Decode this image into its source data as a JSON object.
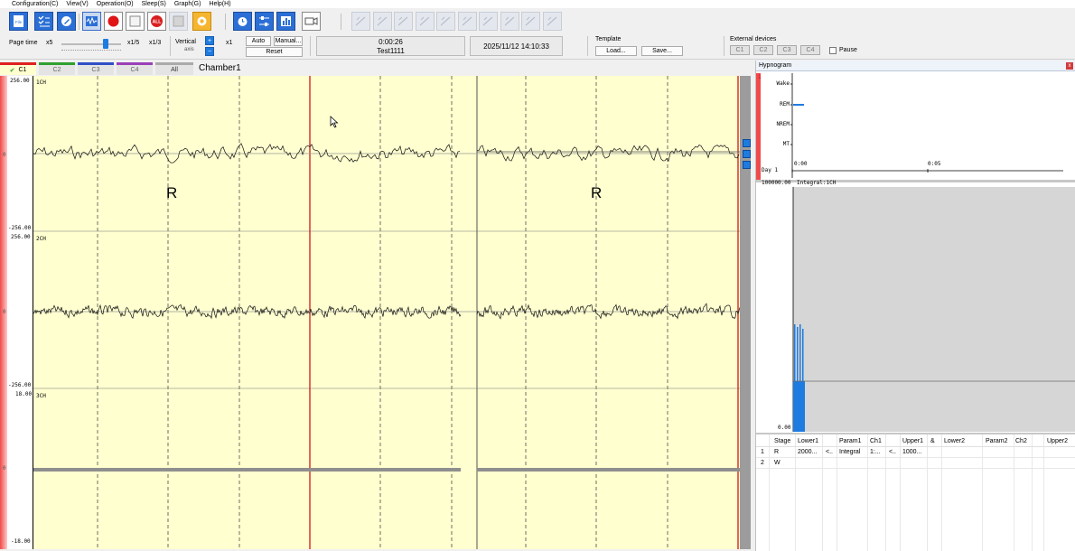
{
  "menu": [
    "Configuration(C)",
    "View(V)",
    "Operation(O)",
    "Sleep(S)",
    "Graph(G)",
    "Help(H)"
  ],
  "toolbar": {
    "file_label": "File",
    "all_label": "ALL"
  },
  "controls": {
    "page_time_label": "Page time",
    "page_time_value": "x5",
    "zoom_a": "x1/5",
    "zoom_b": "x1/3",
    "vertical_label": "Vertical",
    "axis_label": "axis",
    "plus": "+",
    "minus": "−",
    "vertical_value": "x1",
    "auto": "Auto",
    "manual": "Manual...",
    "reset": "Reset",
    "elapsed": "0:00:26",
    "recording_name": "Test1111",
    "datetime": "2025/11/12 14:10:33",
    "template_label": "Template",
    "load": "Load...",
    "save": "Save...",
    "external_label": "External devices",
    "ext": [
      "C1",
      "C2",
      "C3",
      "C4"
    ],
    "pause": "Pause"
  },
  "tabs": [
    "C1",
    "C2",
    "C3",
    "C4",
    "All"
  ],
  "chamber": "Chamber1",
  "channels": [
    {
      "name": "1CH",
      "top": "256.00",
      "bottom": "-256.00",
      "zero": "0"
    },
    {
      "name": "2CH",
      "top": "256.00",
      "bottom": "-256.00",
      "zero": "0"
    },
    {
      "name": "3CH",
      "top": "18.00",
      "bottom": "-18.00",
      "zero": "0"
    }
  ],
  "stage_markers": [
    "R",
    "R"
  ],
  "colors": {
    "plot_bg": "#ffffd0",
    "cursor": "#d01818",
    "bar": "#1e7be0"
  },
  "hypnogram": {
    "title": "Hypnogram",
    "close": "x",
    "stages": [
      "Wake",
      "REM",
      "NREM",
      "MT"
    ],
    "day": "Day 1",
    "t0": "0:00",
    "t1": "0:05",
    "channel_num": "1",
    "integral_top": "100000.00",
    "integral_label": "Integral:1CH",
    "integral_bottom": "0.00"
  },
  "criteria_table": {
    "columns": [
      "Stage",
      "Lower1",
      "",
      "Param1",
      "Ch1",
      "",
      "Upper1",
      "&",
      "Lower2",
      "",
      "Param2",
      "Ch2",
      "",
      "Upper2"
    ],
    "rows": [
      [
        "1",
        "R",
        "2000...",
        "<..",
        "Integral",
        "1:...",
        "<..",
        "1000..."
      ],
      [
        "2",
        "W"
      ]
    ]
  }
}
